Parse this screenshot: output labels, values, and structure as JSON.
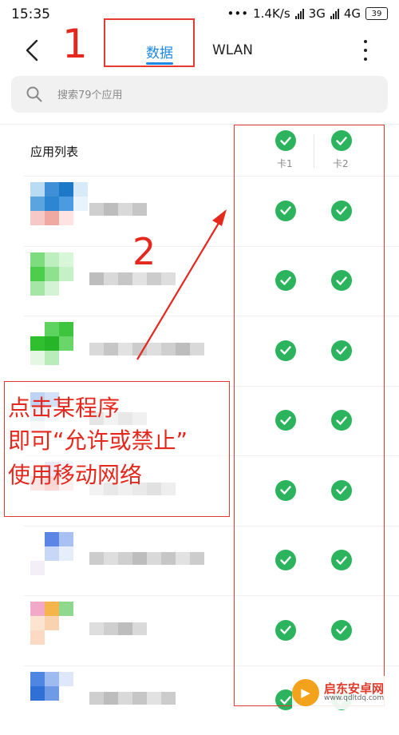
{
  "status_bar": {
    "time": "15:35",
    "dots": "•••",
    "speed": "1.4K/s",
    "net1": "3G",
    "net2": "4G",
    "battery": "39"
  },
  "header": {
    "tabs": [
      {
        "label": "数据",
        "active": true
      },
      {
        "label": "WLAN",
        "active": false
      }
    ],
    "accent_color": "#1e88e5"
  },
  "search": {
    "placeholder": "搜索79个应用",
    "value": ""
  },
  "list": {
    "title": "应用列表",
    "sim_columns": [
      "卡1",
      "卡2"
    ],
    "rows": [
      {
        "app_name": "",
        "sim1_allowed": true,
        "sim2_allowed": true
      },
      {
        "app_name": "",
        "sim1_allowed": true,
        "sim2_allowed": true
      },
      {
        "app_name": "",
        "sim1_allowed": true,
        "sim2_allowed": true
      },
      {
        "app_name": "",
        "sim1_allowed": true,
        "sim2_allowed": true
      },
      {
        "app_name": "",
        "sim1_allowed": true,
        "sim2_allowed": true
      },
      {
        "app_name": "",
        "sim1_allowed": true,
        "sim2_allowed": true
      },
      {
        "app_name": "",
        "sim1_allowed": true,
        "sim2_allowed": true
      },
      {
        "app_name": "",
        "sim1_allowed": true,
        "sim2_allowed": true
      }
    ],
    "check_color": "#2bb45d"
  },
  "annotations": {
    "number1": "1",
    "number2": "2",
    "note_lines": [
      "点击某程序",
      "即可“允许或禁止”",
      "使用移动网络"
    ],
    "color": "#e4281e"
  },
  "watermark": {
    "title": "启东安卓网",
    "url": "www.qdltdq.com"
  }
}
